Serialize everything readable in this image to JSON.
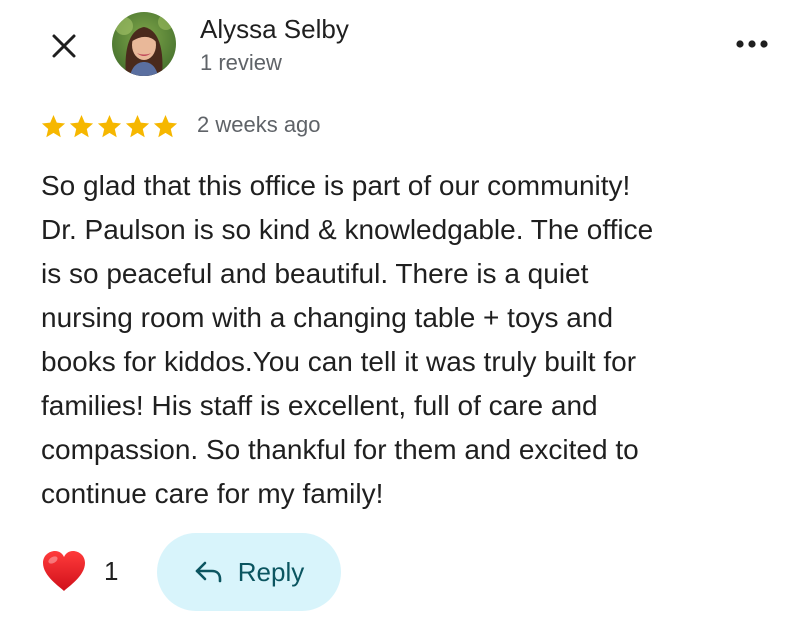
{
  "header": {
    "close_icon": "close-icon",
    "author_name": "Alyssa Selby",
    "review_count": "1 review",
    "more_icon": "more-horizontal-icon"
  },
  "review": {
    "rating": 5,
    "rating_max": 5,
    "star_color": "#f6b700",
    "time_ago": "2 weeks ago",
    "text_lines": [
      "So glad that this office is part of our community!",
      "Dr. Paulson is so kind & knowledgable. The office",
      "is so peaceful and beautiful. There is a quiet",
      "nursing room with a changing table + toys and",
      "books for kiddos.You can tell it was truly built for",
      "families! His staff is excellent, full of care and",
      "compassion. So thankful for them and excited to",
      "continue care for my family!"
    ]
  },
  "actions": {
    "reaction_icon": "heart-icon",
    "reaction_count": "1",
    "reply_icon": "reply-arrow-icon",
    "reply_label": "Reply",
    "reply_bg_color": "#d8f4fb",
    "reply_text_color": "#0b5560"
  }
}
